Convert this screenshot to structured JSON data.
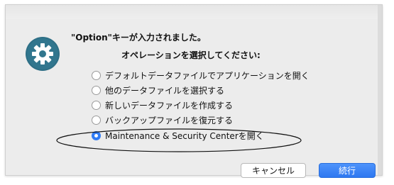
{
  "dialog": {
    "title_line1": "\"Option\"キーが入力されました。",
    "title_line2": "オペレーションを選択してください:",
    "app_icon": "gear-icon",
    "options": [
      {
        "label": "デフォルトデータファイルでアプリケーションを開く",
        "selected": false
      },
      {
        "label": "他のデータファイルを選択する",
        "selected": false
      },
      {
        "label": "新しいデータファイルを作成する",
        "selected": false
      },
      {
        "label": "バックアップファイルを復元する",
        "selected": false
      },
      {
        "label": "Maintenance & Security Centerを開く",
        "selected": true
      }
    ],
    "buttons": {
      "cancel_label": "キャンセル",
      "continue_label": "続行"
    }
  },
  "colors": {
    "accent": "#2f7bf5",
    "dialog_bg": "#ececec",
    "icon_bg": "#2e6f86"
  }
}
